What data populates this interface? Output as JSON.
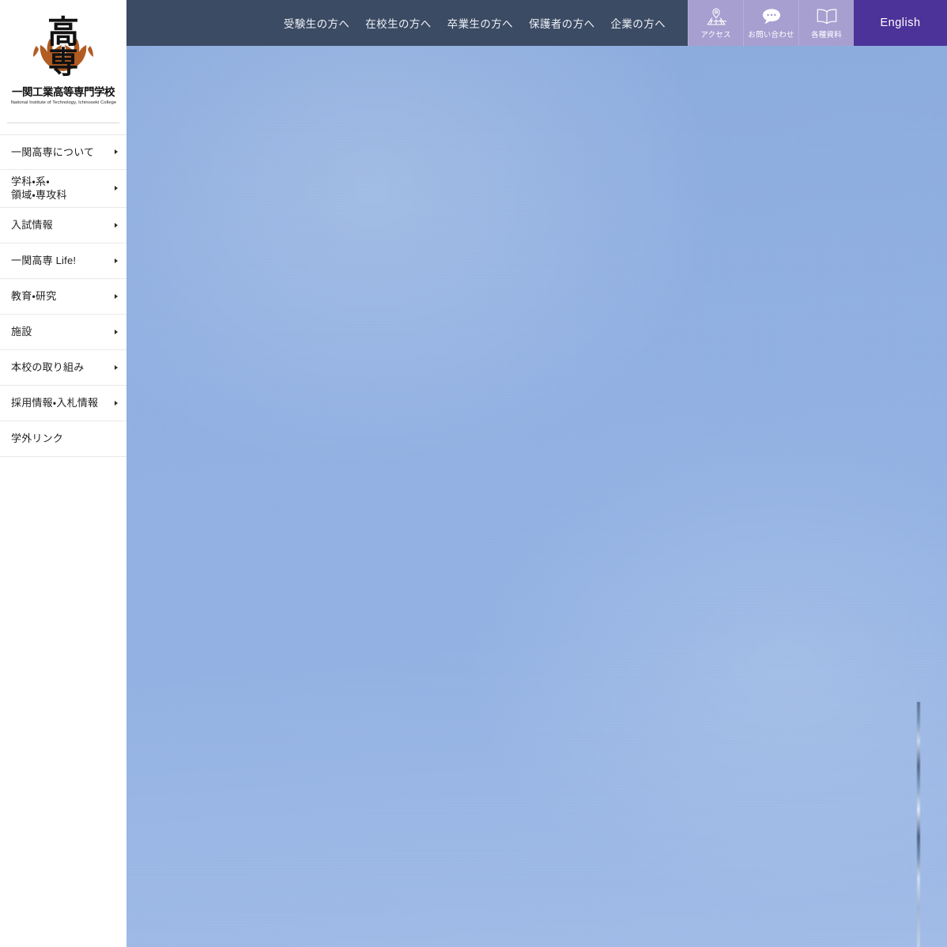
{
  "site": {
    "logo_jp": "一関工業高等専門学校",
    "logo_en": "National Institute of Technology, Ichinoseki College",
    "crest_text_top": "高",
    "crest_text_bottom": "専"
  },
  "colors": {
    "topbar_bg": "#3c4b64",
    "icon_tile_bg": "#a79fd0",
    "english_bg": "#4c3399",
    "hero_sky": "#8fafe3",
    "crest_wreath": "#b05c23",
    "sidebar_bg": "#ffffff",
    "divider": "#e9e9e9"
  },
  "topnav": {
    "links": [
      {
        "label": "受験生の方へ"
      },
      {
        "label": "在校生の方へ"
      },
      {
        "label": "卒業生の方へ"
      },
      {
        "label": "保護者の方へ"
      },
      {
        "label": "企業の方へ"
      }
    ],
    "tiles": [
      {
        "label": "アクセス",
        "icon": "map-pin-icon"
      },
      {
        "label": "お問い合わせ",
        "icon": "speech-bubble-icon"
      },
      {
        "label": "各種資料",
        "icon": "open-book-icon"
      }
    ],
    "english_label": "English"
  },
  "sidebar": {
    "items": [
      {
        "label": "一関高専について",
        "has_arrow": true
      },
      {
        "label": "学科・系・\n領域・専攻科",
        "has_arrow": true
      },
      {
        "label": "入試情報",
        "has_arrow": true
      },
      {
        "label": "一関高専 Life!",
        "has_arrow": true
      },
      {
        "label": "教育・研究",
        "has_arrow": true
      },
      {
        "label": "施設",
        "has_arrow": true
      },
      {
        "label": "本校の取り組み",
        "has_arrow": true
      },
      {
        "label": "採用情報・入札情報",
        "has_arrow": true
      },
      {
        "label": "学外リンク",
        "has_arrow": false
      }
    ]
  }
}
